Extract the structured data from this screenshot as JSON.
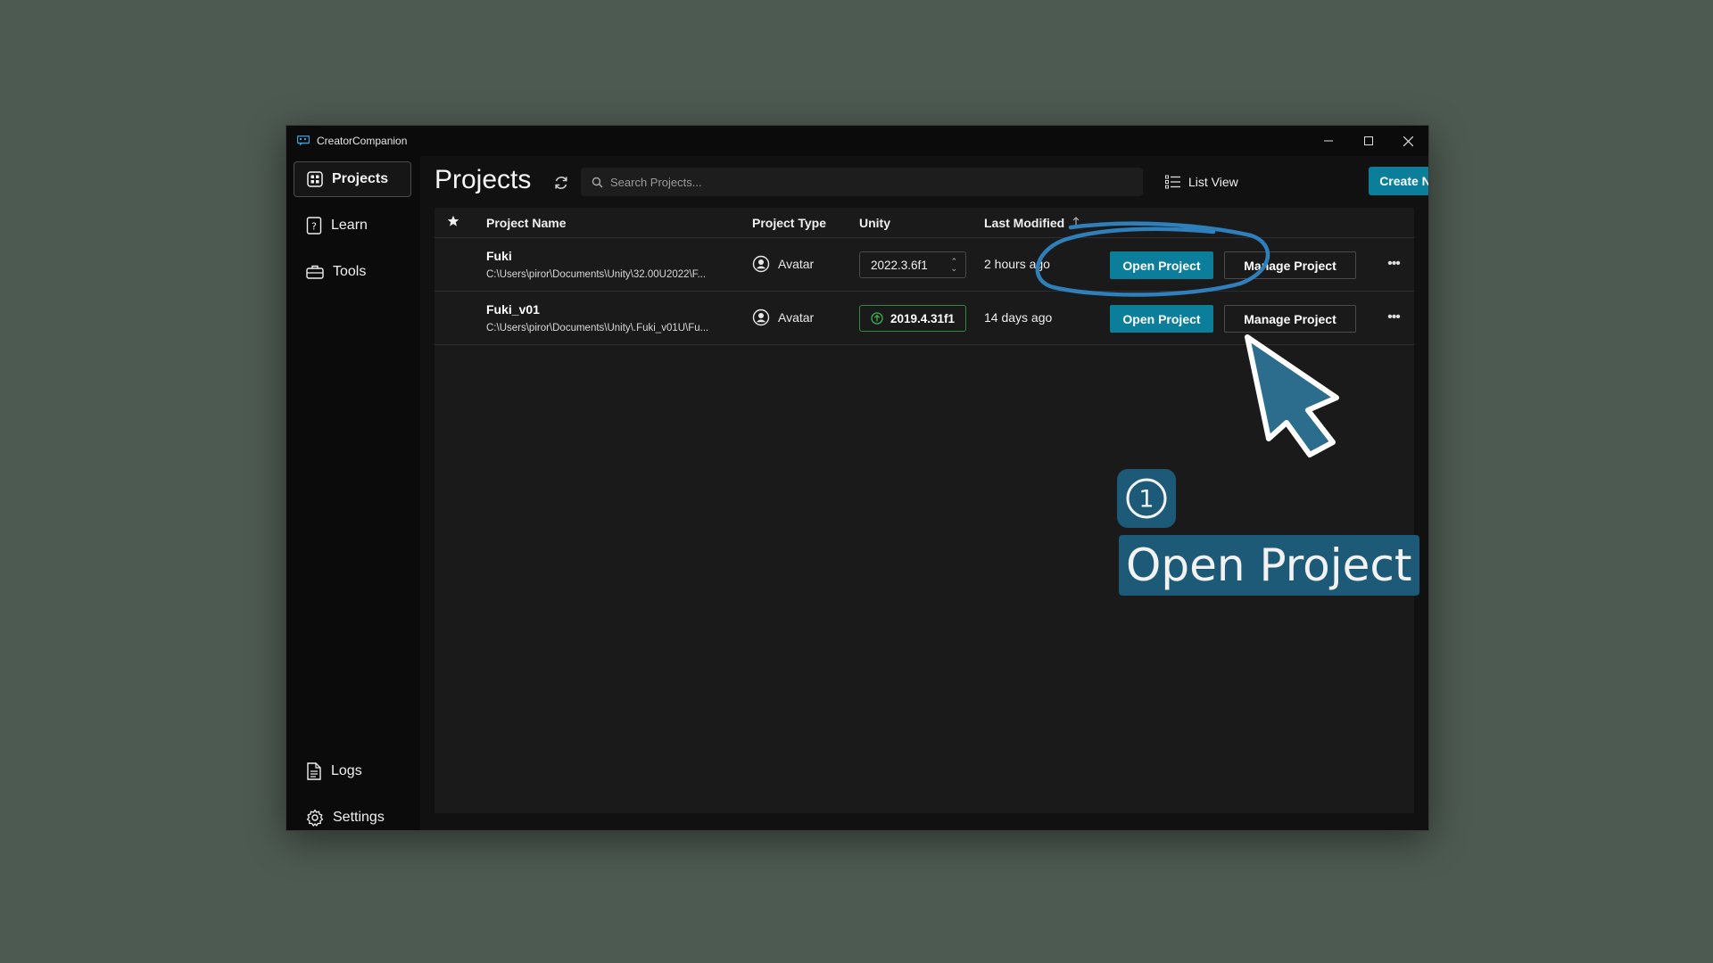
{
  "window": {
    "title": "CreatorCompanion",
    "controls": [
      "minimize",
      "maximize",
      "close"
    ]
  },
  "sidebar": {
    "items": [
      {
        "label": "Projects",
        "icon": "grid-icon",
        "active": true
      },
      {
        "label": "Learn",
        "icon": "help-book-icon"
      },
      {
        "label": "Tools",
        "icon": "toolbox-icon"
      }
    ],
    "bottom_items": [
      {
        "label": "Logs",
        "icon": "document-icon"
      },
      {
        "label": "Settings",
        "icon": "gear-icon"
      }
    ]
  },
  "header": {
    "title": "Projects",
    "search_placeholder": "Search Projects...",
    "list_view_label": "List View",
    "create_label": "Create New Project"
  },
  "table": {
    "columns": {
      "name": "Project Name",
      "type": "Project Type",
      "unity": "Unity",
      "modified": "Last Modified"
    },
    "rows": [
      {
        "name": "Fuki",
        "path": "C:\\Users\\piror\\Documents\\Unity\\32.00U2022\\F...",
        "type": "Avatar",
        "unity": "2022.3.6f1",
        "unity_needs_upgrade": false,
        "modified": "2 hours ago",
        "open_label": "Open Project",
        "manage_label": "Manage Project"
      },
      {
        "name": "Fuki_v01",
        "path": "C:\\Users\\piror\\Documents\\Unity\\.Fuki_v01U\\Fu...",
        "type": "Avatar",
        "unity": "2019.4.31f1",
        "unity_needs_upgrade": true,
        "modified": "14 days ago",
        "open_label": "Open Project",
        "manage_label": "Manage Project"
      }
    ]
  },
  "annotation": {
    "step_number": "1",
    "label": "Open Project",
    "color": "#1d5a78"
  },
  "colors": {
    "accent": "#0b7e9c",
    "upgrade": "#2d8a3d",
    "background": "#4d5a51"
  }
}
